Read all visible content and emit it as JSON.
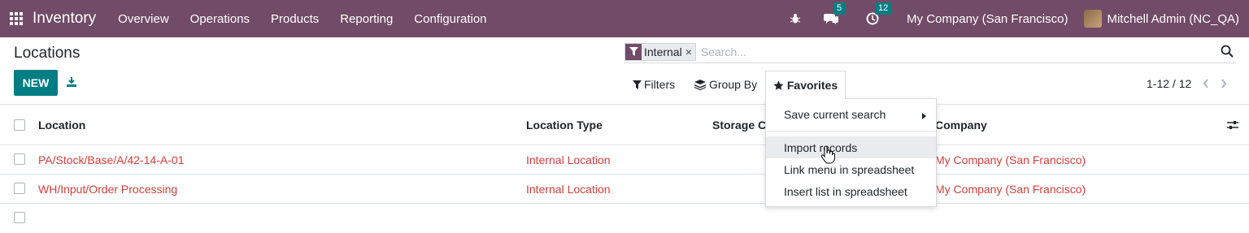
{
  "navbar": {
    "app_name": "Inventory",
    "menu": [
      "Overview",
      "Operations",
      "Products",
      "Reporting",
      "Configuration"
    ],
    "messages_count": "5",
    "activities_count": "12",
    "company": "My Company (San Francisco)",
    "user": "Mitchell Admin (NC_QA)",
    "brand_color": "#714b67"
  },
  "control_panel": {
    "title": "Locations",
    "new_label": "NEW",
    "search": {
      "facet_value": "Internal",
      "facet_remove": "×",
      "placeholder": "Search..."
    },
    "filters_label": "Filters",
    "groupby_label": "Group By",
    "favorites_label": "Favorites",
    "pager": "1-12 / 12"
  },
  "favorites_menu": {
    "items": [
      "Save current search",
      "Import records",
      "Link menu in spreadsheet",
      "Insert list in spreadsheet"
    ]
  },
  "list": {
    "columns": [
      "Location",
      "Location Type",
      "Storage C",
      "Company"
    ],
    "rows": [
      {
        "location": "PA/Stock/Base/A/42-14-A-01",
        "type": "Internal Location",
        "company": "My Company (San Francisco)"
      },
      {
        "location": "WH/Input/Order Processing",
        "type": "Internal Location",
        "company": "My Company (San Francisco)"
      }
    ]
  },
  "colors": {
    "accent": "#017e84",
    "link_red": "#d23f3a"
  }
}
